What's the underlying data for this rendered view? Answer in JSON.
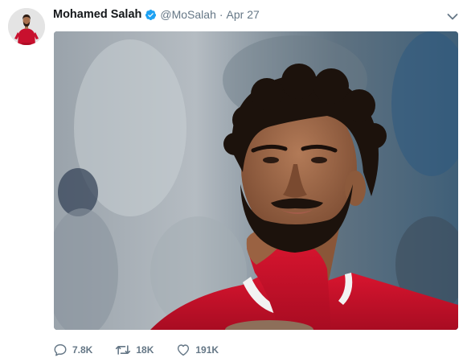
{
  "tweet": {
    "author_name": "Mohamed Salah",
    "handle": "@MoSalah",
    "separator": "·",
    "date": "Apr 27",
    "verified": true,
    "colors": {
      "name": "#14171a",
      "secondary": "#657786",
      "verified_badge": "#1da1f2",
      "kit_red": "#c8102e"
    }
  },
  "icons": {
    "verified": "verified-badge-icon",
    "caret": "chevron-down-icon",
    "reply": "reply-icon",
    "retweet": "retweet-icon",
    "like": "heart-icon"
  },
  "actions": {
    "replies": "7.8K",
    "retweets": "18K",
    "likes": "191K"
  }
}
